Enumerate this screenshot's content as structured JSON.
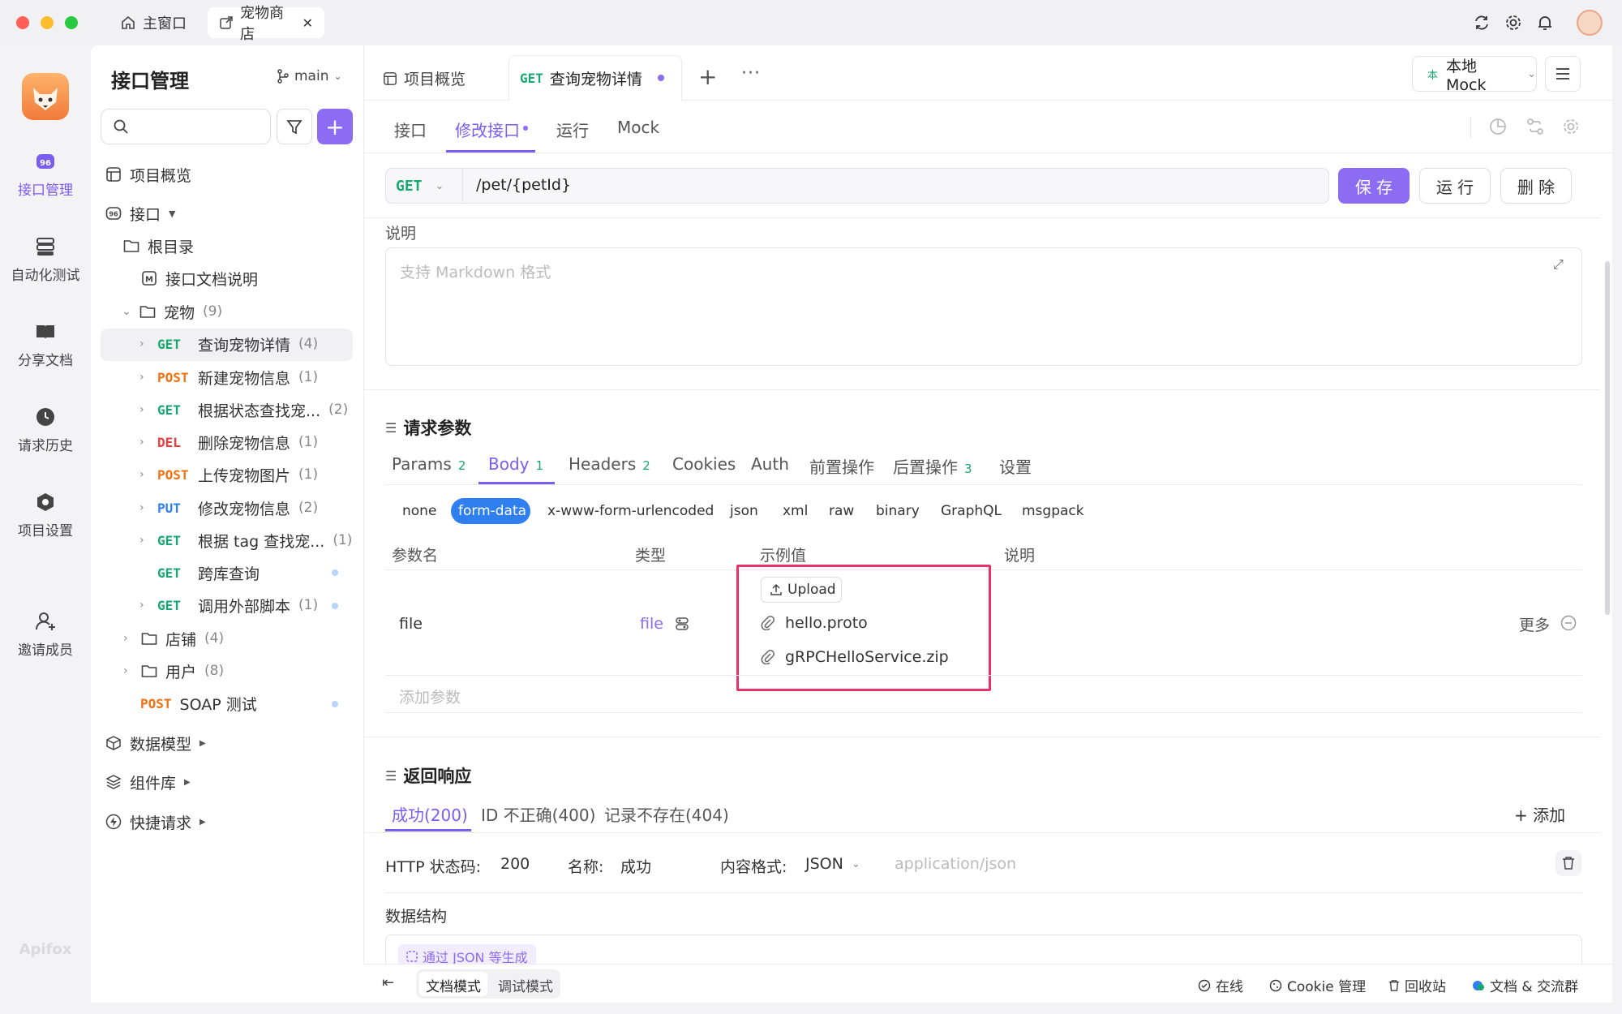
{
  "titlebar": {
    "tabs": [
      {
        "label": "主窗口",
        "icon": "home-icon"
      },
      {
        "label": "宠物商店",
        "icon": "external-link-icon"
      }
    ]
  },
  "rail": {
    "items": [
      {
        "label": "接口管理",
        "icon": "api-icon",
        "active": true
      },
      {
        "label": "自动化测试",
        "icon": "automation-icon"
      },
      {
        "label": "分享文档",
        "icon": "book-icon"
      },
      {
        "label": "请求历史",
        "icon": "clock-icon"
      },
      {
        "label": "项目设置",
        "icon": "settings-icon"
      },
      {
        "label": "邀请成员",
        "icon": "add-user-icon"
      }
    ],
    "brand": "Apifox"
  },
  "sidebar": {
    "title": "接口管理",
    "branch": "main",
    "search_placeholder": "",
    "overview": "项目概览",
    "api_root": "接口",
    "root_dir": "根目录",
    "doc_item": "接口文档说明",
    "pet_folder": {
      "name": "宠物",
      "count": "(9)"
    },
    "endpoints": [
      {
        "method": "GET",
        "name": "查询宠物详情",
        "count": "(4)"
      },
      {
        "method": "POST",
        "name": "新建宠物信息",
        "count": "(1)"
      },
      {
        "method": "GET",
        "name": "根据状态查找宠...",
        "count": "(2)"
      },
      {
        "method": "DEL",
        "name": "删除宠物信息",
        "count": "(1)"
      },
      {
        "method": "POST",
        "name": "上传宠物图片",
        "count": "(1)"
      },
      {
        "method": "PUT",
        "name": "修改宠物信息",
        "count": "(2)"
      },
      {
        "method": "GET",
        "name": "根据 tag 查找宠...",
        "count": "(1)"
      },
      {
        "method": "GET",
        "name": "跨库查询",
        "count": ""
      },
      {
        "method": "GET",
        "name": "调用外部脚本",
        "count": "(1)"
      }
    ],
    "shop_folder": {
      "name": "店铺",
      "count": "(4)"
    },
    "user_folder": {
      "name": "用户",
      "count": "(8)"
    },
    "soap": {
      "method": "POST",
      "name": "SOAP 测试"
    },
    "bottom": [
      "数据模型",
      "组件库",
      "快捷请求"
    ]
  },
  "header": {
    "tab_overview": "项目概览",
    "tab_active_method": "GET",
    "tab_active_name": "查询宠物详情",
    "env": "本地 Mock",
    "env_badge": "本"
  },
  "subtabs": [
    "接口",
    "修改接口",
    "运行",
    "Mock"
  ],
  "request": {
    "method": "GET",
    "path": "/pet/{petId}",
    "save": "保 存",
    "run": "运 行",
    "delete": "删 除"
  },
  "description": {
    "label": "说明",
    "placeholder": "支持 Markdown 格式"
  },
  "params": {
    "title": "请求参数",
    "tabs": [
      {
        "label": "Params",
        "badge": "2"
      },
      {
        "label": "Body",
        "badge": "1"
      },
      {
        "label": "Headers",
        "badge": "2"
      },
      {
        "label": "Cookies",
        "badge": ""
      },
      {
        "label": "Auth",
        "badge": ""
      },
      {
        "label": "前置操作",
        "badge": ""
      },
      {
        "label": "后置操作",
        "badge": "3"
      },
      {
        "label": "设置",
        "badge": ""
      }
    ],
    "body_types": [
      "none",
      "form-data",
      "x-www-form-urlencoded",
      "json",
      "xml",
      "raw",
      "binary",
      "GraphQL",
      "msgpack"
    ],
    "columns": [
      "参数名",
      "类型",
      "示例值",
      "说明"
    ],
    "row": {
      "name": "file",
      "type": "file",
      "upload": "Upload",
      "files": [
        "hello.proto",
        "gRPCHelloService.zip"
      ],
      "more": "更多"
    },
    "add_param": "添加参数"
  },
  "response": {
    "title": "返回响应",
    "tabs": [
      "成功(200)",
      "ID 不正确(400)",
      "记录不存在(404)"
    ],
    "add": "+ 添加",
    "status_label": "HTTP 状态码:",
    "status_value": "200",
    "name_label": "名称:",
    "name_value": "成功",
    "format_label": "内容格式:",
    "format_value": "JSON",
    "format_mime": "application/json",
    "schema_label": "数据结构",
    "gen_button": "通过 JSON 等生成"
  },
  "footer": {
    "modes": [
      "文档模式",
      "调试模式"
    ],
    "items": [
      "在线",
      "Cookie 管理",
      "回收站",
      "文档 & 交流群"
    ]
  },
  "colors": {
    "accent": "#7b5cf0",
    "highlight_box": "#e8336a",
    "get": "#17a870",
    "post": "#f0700f",
    "del": "#ee3b3b",
    "put": "#2f7ff0"
  }
}
